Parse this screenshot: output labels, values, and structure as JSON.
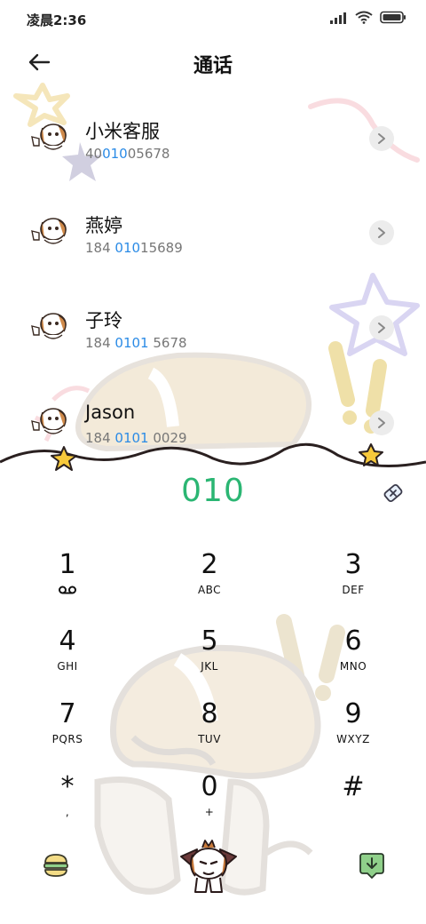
{
  "status_bar": {
    "time": "凌晨2:36"
  },
  "header": {
    "title": "通话"
  },
  "contacts": [
    {
      "name": "小米客服",
      "number_pre": "40",
      "number_hl": "010",
      "number_post": "05678"
    },
    {
      "name": "燕婷",
      "number_pre": "184 ",
      "number_hl": "010",
      "number_post": "15689"
    },
    {
      "name": "子玲",
      "number_pre": "184 ",
      "number_hl": "0101",
      "number_post": " 5678"
    },
    {
      "name": "Jason",
      "number_pre": "184 ",
      "number_hl": "0101",
      "number_post": " 0029"
    }
  ],
  "dialer": {
    "input": "010"
  },
  "keypad": [
    {
      "digit": "1",
      "letters": ""
    },
    {
      "digit": "2",
      "letters": "ABC"
    },
    {
      "digit": "3",
      "letters": "DEF"
    },
    {
      "digit": "4",
      "letters": "GHI"
    },
    {
      "digit": "5",
      "letters": "JKL"
    },
    {
      "digit": "6",
      "letters": "MNO"
    },
    {
      "digit": "7",
      "letters": "PQRS"
    },
    {
      "digit": "8",
      "letters": "TUV"
    },
    {
      "digit": "9",
      "letters": "WXYZ"
    },
    {
      "digit": "*",
      "letters": ","
    },
    {
      "digit": "0",
      "letters": "+"
    },
    {
      "digit": "#",
      "letters": ""
    }
  ],
  "icons": {
    "back": "arrow-left-icon",
    "chevron": "chevron-right-icon",
    "eraser": "eraser-icon",
    "voicemail": "voicemail-icon",
    "menu": "burger-menu-icon",
    "call": "dog-call-icon",
    "hide": "hide-keypad-icon"
  },
  "colors": {
    "accent_green": "#2bb673",
    "match_blue": "#2b8be6"
  }
}
